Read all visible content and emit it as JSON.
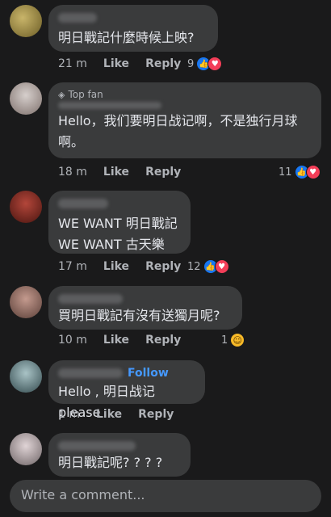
{
  "comments": [
    {
      "text": "明日戰記什麼時候上映?",
      "time": "21 m",
      "like": "Like",
      "reply": "Reply",
      "reaction_count": "9",
      "reactions": [
        "like-icon",
        "love-icon"
      ],
      "avatar_color": "#8a7b3a"
    },
    {
      "badge": "Top fan",
      "text": "Hello，我们要明日战记啊，不是独行月球\n啊。",
      "time": "18 m",
      "like": "Like",
      "reply": "Reply",
      "reaction_count": "11",
      "reactions": [
        "like-icon",
        "love-icon"
      ],
      "avatar_color": "#9e8f8a"
    },
    {
      "text": "WE WANT 明日戰記\nWE WANT 古天樂",
      "time": "17 m",
      "like": "Like",
      "reply": "Reply",
      "reaction_count": "12",
      "reactions": [
        "like-icon",
        "love-icon"
      ],
      "avatar_color": "#7a2a22"
    },
    {
      "text": "買明日戰記有沒有送獨月呢?",
      "time": "10 m",
      "like": "Like",
      "reply": "Reply",
      "reaction_count": "1",
      "reactions": [
        "haha-icon"
      ],
      "avatar_color": "#8a6a62"
    },
    {
      "follow": "Follow",
      "text": "Hello , 明日战记please",
      "time": "1 m",
      "like": "Like",
      "reply": "Reply",
      "avatar_color": "#5f7b80"
    },
    {
      "text": "明日戰記呢? ? ? ?",
      "avatar_color": "#a69a9c"
    }
  ],
  "composer": {
    "placeholder": "Write a comment..."
  },
  "colors": {
    "background": "#1a1a1b",
    "bubble": "#3a3b3c",
    "accent_link": "#4599ff",
    "like_blue": "#1877f2",
    "love_red": "#f33e58"
  }
}
